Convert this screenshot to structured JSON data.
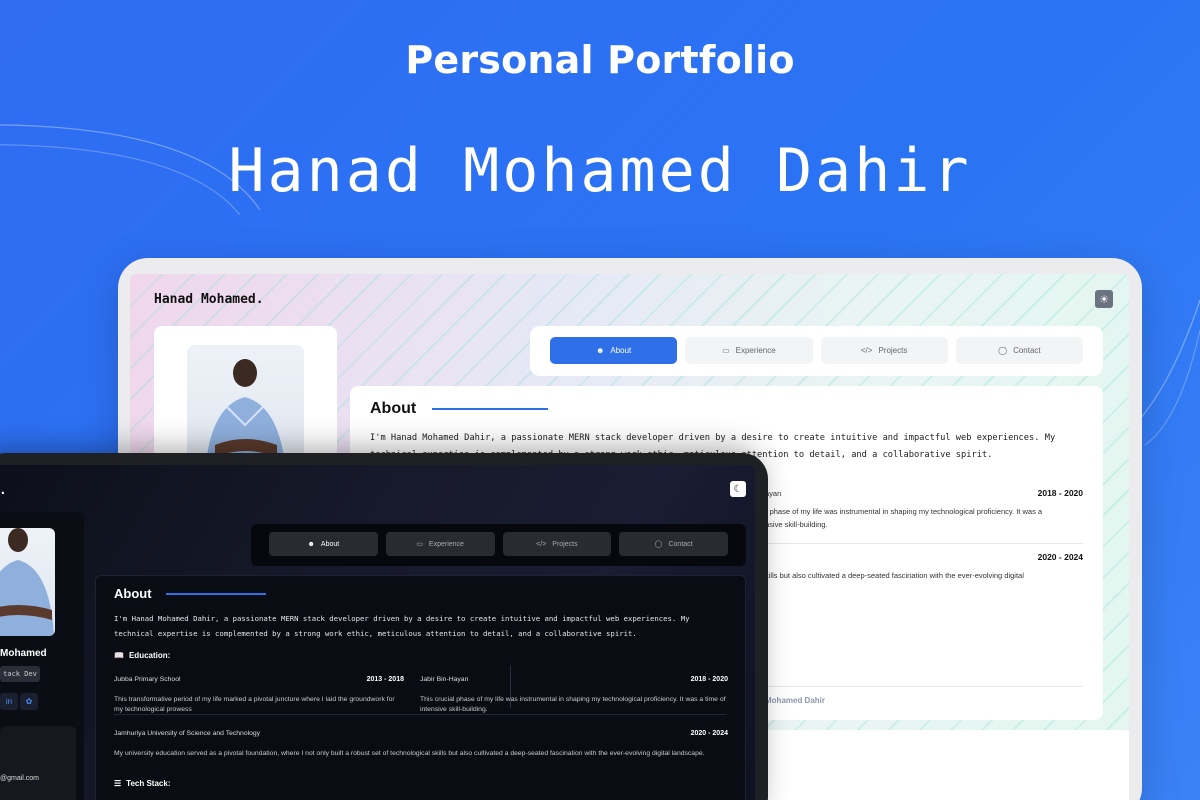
{
  "hero": {
    "label": "Personal Portfolio",
    "name": "Hanad Mohamed Dahir"
  },
  "colors": {
    "background": "#2f6cf2",
    "accent": "#2f6fe8",
    "dark_surface": "#0a0c13",
    "light_surface": "#ffffff"
  },
  "light_view": {
    "logo": "Hanad Mohamed.",
    "theme_icon": "sun-icon",
    "nav": [
      {
        "label": "About",
        "icon": "user-icon",
        "active": true
      },
      {
        "label": "Experience",
        "icon": "briefcase-icon",
        "active": false
      },
      {
        "label": "Projects",
        "icon": "code-icon",
        "active": false
      },
      {
        "label": "Contact",
        "icon": "chat-icon",
        "active": false
      }
    ],
    "about": {
      "title": "About",
      "text": "I'm Hanad Mohamed Dahir, a passionate MERN stack developer driven by a desire to create intuitive and impactful web experiences. My technical expertise is complemented by a strong work ethic, meticulous attention to detail, and a collaborative spirit."
    },
    "edu_fragment_1": {
      "name": "ayan",
      "year": "2018 - 2020",
      "line1": ") phase of my life was instrumental in shaping my technological proficiency. It was a",
      "line2": "nsive skill-building."
    },
    "edu_fragment_2": {
      "year": "2020 - 2024",
      "line1": "kills but also cultivated a deep-seated fascination with the ever-evolving digital"
    },
    "footer": "Mohamed Dahir"
  },
  "dark_view": {
    "logo": "d.",
    "theme_icon": "moon-icon",
    "profile": {
      "name": "Mohamed",
      "role": "tack Dev",
      "email": "@gmail.com"
    },
    "nav": [
      {
        "label": "About",
        "icon": "user-icon",
        "active": true
      },
      {
        "label": "Experience",
        "icon": "briefcase-icon",
        "active": false
      },
      {
        "label": "Projects",
        "icon": "code-icon",
        "active": false
      },
      {
        "label": "Contact",
        "icon": "chat-icon",
        "active": false
      }
    ],
    "about": {
      "title": "About",
      "text": "I'm Hanad Mohamed Dahir, a passionate MERN stack developer driven by a desire to create intuitive and impactful web experiences. My technical expertise is complemented by a strong work ethic, meticulous attention to detail, and a collaborative spirit."
    },
    "education_heading": "Education:",
    "education": [
      {
        "school": "Jubba Primary School",
        "years": "2013 - 2018",
        "desc": "This transformative period of my life marked a pivotal juncture where I laid the groundwork for my technological prowess"
      },
      {
        "school": "Jabir Bin-Hayan",
        "years": "2018 - 2020",
        "desc": "This crucial phase of my life was instrumental in shaping my technological proficiency. It was a time of intensive skill-building."
      },
      {
        "school": "Jamhuriya University of Science and Technology",
        "years": "2020 - 2024",
        "desc": "My university education served as a pivotal foundation, where I not only built a robust set of technological skills but also cultivated a deep-seated fascination with the ever-evolving digital landscape."
      }
    ],
    "tech_heading": "Tech Stack:",
    "tech_icons": [
      "nextjs-icon",
      "mongodb-icon",
      "express-icon",
      "node-icon",
      "react-icon",
      "typescript-icon",
      "firebase-icon",
      "figma-icon"
    ]
  }
}
